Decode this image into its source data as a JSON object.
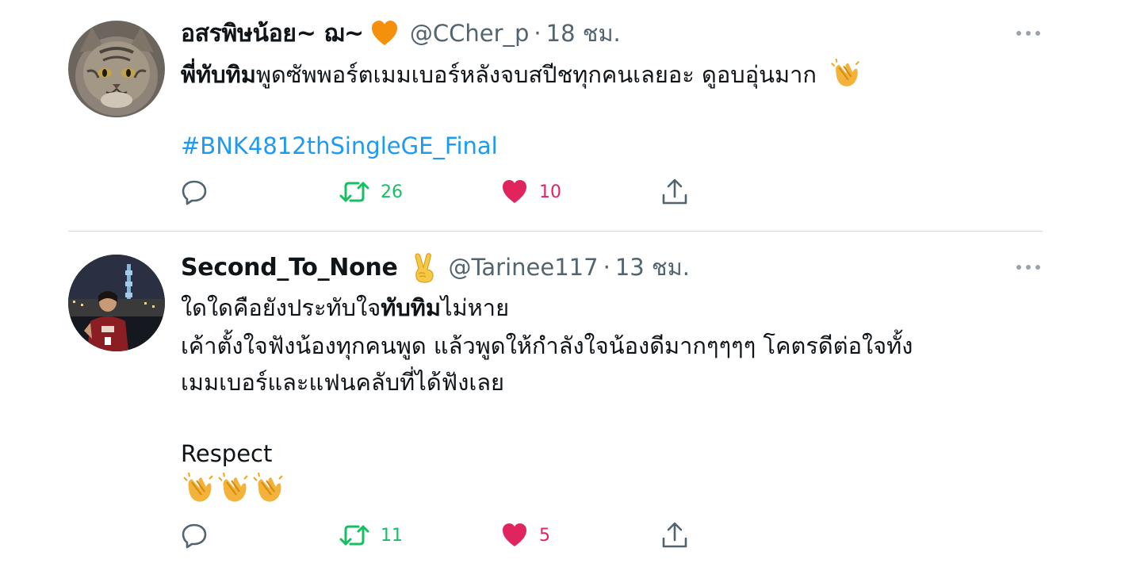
{
  "tweets": [
    {
      "display_name": "อสรพิษน้อย~ ฌ~",
      "name_emoji": "orange-heart-icon",
      "handle": "@CCher_p",
      "dot": "·",
      "time": "18 ชม.",
      "text_bold": "พี่ทับทิม",
      "text_rest": "พูดซัพพอร์ตเมมเบอร์หลังจบสปีชทุกคนเลยอะ ดูอบอุ่นมาก",
      "text_emoji": "clapping-hands-icon",
      "hashtag": "#BNK4812thSingleGE_Final",
      "retweets": "26",
      "likes": "10"
    },
    {
      "display_name": "Second_To_None",
      "name_emoji": "victory-hand-icon",
      "handle": "@Tarinee117",
      "dot": "·",
      "time": "13 ชม.",
      "line1_pre": "ใดใดคือยังประทับใจ",
      "line1_bold": "ทับทิม",
      "line1_post": "ไม่หาย",
      "line2": "เค้าตั้งใจฟังน้องทุกคนพูด แล้วพูดให้กำลังใจน้องดีมากๆๆๆๆ โคตรดีต่อใจทั้ง",
      "line3": "เมมเบอร์และแฟนคลับที่ได้ฟังเลย",
      "line4": "Respect",
      "end_emoji": [
        "clapping-hands-icon",
        "clapping-hands-icon",
        "clapping-hands-icon"
      ],
      "retweets": "11",
      "likes": "5"
    }
  ],
  "colors": {
    "text": "#0f1419",
    "secondary": "#536471",
    "link": "#1d9bf0",
    "retweet": "#17bf63",
    "like": "#e0245e",
    "divider": "#cfd9de"
  }
}
